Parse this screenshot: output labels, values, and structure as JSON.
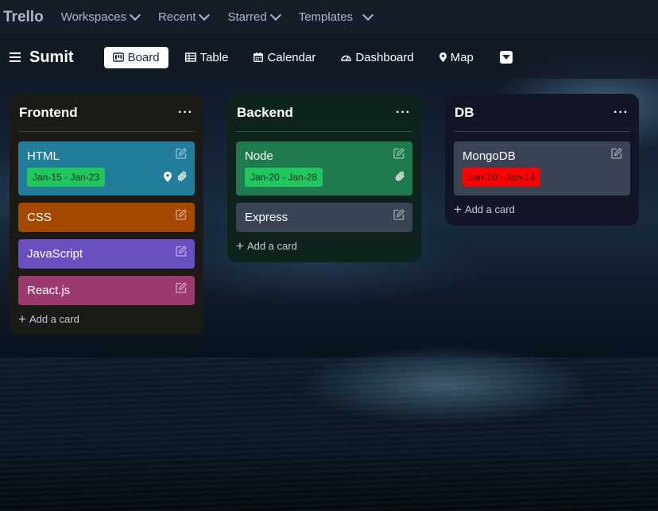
{
  "topnav": {
    "brand": "Trello",
    "items": [
      {
        "label": "Workspaces"
      },
      {
        "label": "Recent"
      },
      {
        "label": "Starred"
      },
      {
        "label": "Templates"
      }
    ]
  },
  "board": {
    "title": "Sumit",
    "views": [
      {
        "label": "Board",
        "icon": "board-icon",
        "active": true
      },
      {
        "label": "Table",
        "icon": "table-icon"
      },
      {
        "label": "Calendar",
        "icon": "calendar-icon"
      },
      {
        "label": "Dashboard",
        "icon": "dashboard-icon"
      },
      {
        "label": "Map",
        "icon": "map-pin-icon"
      }
    ]
  },
  "lists": [
    {
      "title": "Frontend",
      "menu": "···",
      "add_card": "Add a card",
      "bg": "#1b1a17",
      "cards": [
        {
          "title": "HTML",
          "color": "#227d9b",
          "dates": "Jan-15 - Jan-23",
          "date_color": "#22c55e",
          "date_text_color": "#14351f",
          "icons": [
            "location-icon",
            "attachment-icon"
          ]
        },
        {
          "title": "CSS",
          "color": "#a54800"
        },
        {
          "title": "JavaScript",
          "color": "#6a4fc0"
        },
        {
          "title": "React.js",
          "color": "#9c3a6e"
        }
      ]
    },
    {
      "title": "Backend",
      "menu": "···",
      "add_card": "Add a card",
      "bg": "#0e231c",
      "cards": [
        {
          "title": "Node",
          "color": "#1f7a4d",
          "dates": "Jan-20 - Jan-28",
          "date_color": "#22c55e",
          "date_text_color": "#14351f",
          "icons": [
            "attachment-icon"
          ]
        },
        {
          "title": "Express",
          "color": "#3a4454"
        }
      ]
    },
    {
      "title": "DB",
      "menu": "···",
      "add_card": "Add a card",
      "bg": "#121626",
      "cards": [
        {
          "title": "MongoDB",
          "color": "#3a4454",
          "dates": "Jan-10 - Jan-14",
          "date_color": "#ff0000",
          "date_text_color": "#3b0000"
        }
      ]
    }
  ]
}
